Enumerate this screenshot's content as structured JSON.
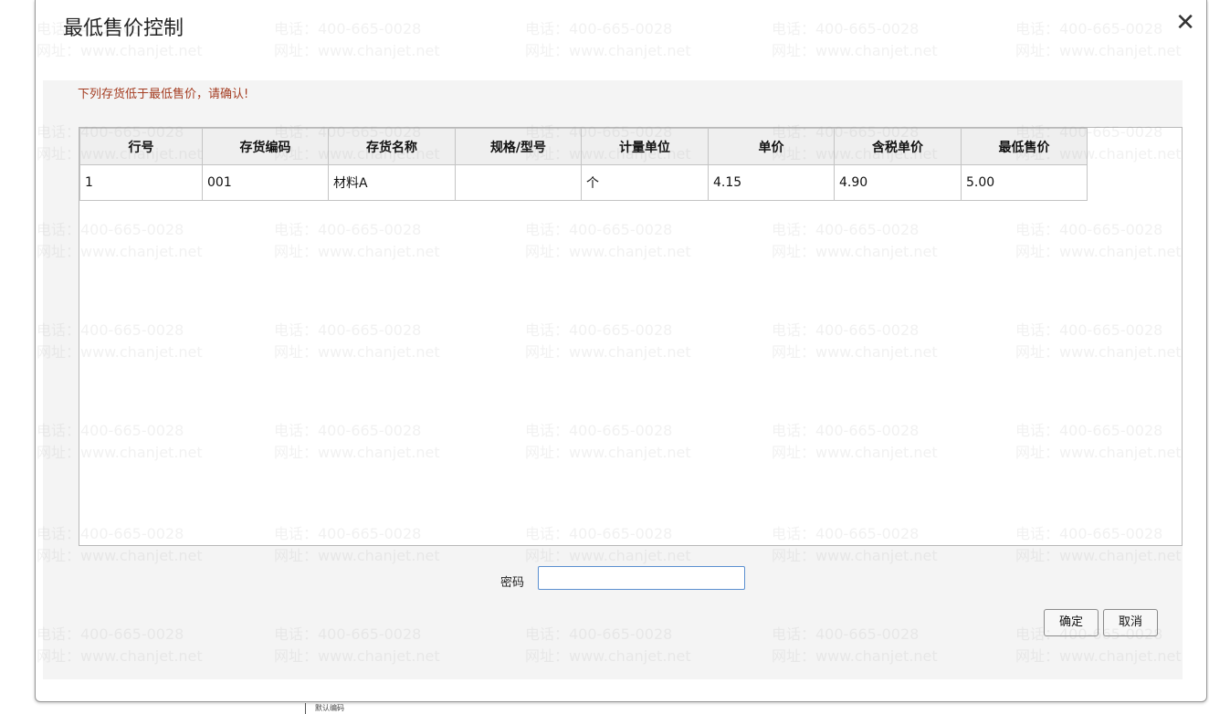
{
  "dialog": {
    "title": "最低售价控制",
    "close_glyph": "✕",
    "warning": "下列存货低于最低售价，请确认!",
    "password_label": "密码",
    "password_value": "",
    "ok_label": "确定",
    "cancel_label": "取消"
  },
  "table": {
    "columns": [
      "行号",
      "存货编码",
      "存货名称",
      "规格/型号",
      "计量单位",
      "单价",
      "含税单价",
      "最低售价"
    ],
    "rows": [
      [
        "1",
        "001",
        "材料A",
        "",
        "个",
        "4.15",
        "4.90",
        "5.00"
      ]
    ]
  },
  "watermark": {
    "phone": "电话：400-665-0028",
    "site": "网址：www.chanjet.net"
  },
  "background": {
    "strip_text": "默认编码"
  },
  "colors": {
    "warning": "#a43d22",
    "input_border": "#5a8fd0"
  }
}
